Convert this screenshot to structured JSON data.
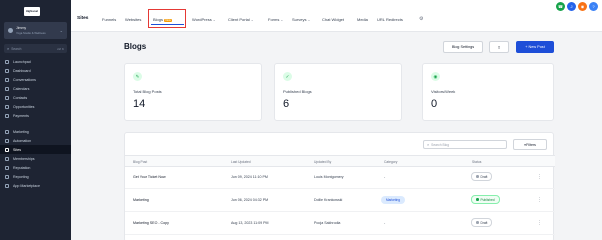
{
  "logo_text": "HighLevel",
  "account": {
    "name": "Jimmy",
    "sub": "Yoga Studio & Wellness"
  },
  "sidebar": {
    "search_placeholder": "Search",
    "search_kbd": "ctrl K",
    "items": [
      {
        "label": "Launchpad",
        "icon": "rocket-icon"
      },
      {
        "label": "Dashboard",
        "icon": "dashboard-icon"
      },
      {
        "label": "Conversations",
        "icon": "chat-icon"
      },
      {
        "label": "Calendars",
        "icon": "calendar-icon"
      },
      {
        "label": "Contacts",
        "icon": "contacts-icon"
      },
      {
        "label": "Opportunities",
        "icon": "funnel-icon"
      },
      {
        "label": "Payments",
        "icon": "payments-icon"
      },
      {
        "label": "Marketing",
        "icon": "megaphone-icon"
      },
      {
        "label": "Automation",
        "icon": "automation-icon"
      },
      {
        "label": "Sites",
        "icon": "globe-icon"
      },
      {
        "label": "Memberships",
        "icon": "membership-icon"
      },
      {
        "label": "Reputation",
        "icon": "star-icon"
      },
      {
        "label": "Reporting",
        "icon": "chart-icon"
      },
      {
        "label": "App Marketplace",
        "icon": "apps-icon"
      }
    ]
  },
  "topbar": {
    "brand": "Sites",
    "tabs": [
      {
        "label": "Funnels"
      },
      {
        "label": "Websites"
      },
      {
        "label": "Blogs",
        "badge": "New"
      },
      {
        "label": "WordPress",
        "chevron": true
      },
      {
        "label": "Client Portal",
        "chevron": true
      },
      {
        "label": "Forms",
        "chevron": true
      },
      {
        "label": "Surveys",
        "chevron": true
      },
      {
        "label": "Chat Widget"
      },
      {
        "label": "Media"
      },
      {
        "label": "URL Redirects"
      }
    ],
    "user_circles": [
      {
        "color": "#16a34a",
        "letter": "☎",
        "name": "phone-icon"
      },
      {
        "color": "#2563eb",
        "letter": "J",
        "name": "avatar"
      },
      {
        "color": "#f97316",
        "letter": "◉",
        "name": "notification-icon"
      },
      {
        "color": "#3b82f6",
        "letter": "?",
        "name": "help-icon"
      },
      {
        "color": "#8b5cf6",
        "letter": "R",
        "name": "user-avatar"
      }
    ]
  },
  "main": {
    "title": "Blogs",
    "buttons": {
      "site_settings": "Blog Settings",
      "new_post": "+ New Post"
    },
    "cards": [
      {
        "label": "Total Blog Posts",
        "value": "14"
      },
      {
        "label": "Published Blogs",
        "value": "6"
      },
      {
        "label": "Visitors/Week",
        "value": "0"
      }
    ],
    "table": {
      "search_placeholder": "Search Blog",
      "filter_label": "Filters",
      "headers": [
        "Blog Post",
        "Last Updated",
        "Updated By",
        "Category",
        "Status"
      ],
      "rows": [
        {
          "title": "Get Your Ticket Now",
          "updated": "Jun 09, 2024 11:10 PM",
          "by": "Louis Montgomery",
          "category": "-",
          "status": "Draft"
        },
        {
          "title": "Marketing",
          "updated": "Jun 06, 2024 04:32 PM",
          "by": "Dollie Krankowski",
          "category": "Marketing",
          "status": "Published"
        },
        {
          "title": "Marketing SEO - Copy",
          "updated": "Aug 13, 2023 11:09 PM",
          "by": "Pooja Sakhrodia",
          "category": "-",
          "status": "Draft"
        }
      ]
    }
  },
  "colors": {
    "accent": "#1d4ed8",
    "highlight": "#e53935",
    "sidebar_bg": "#1e2433"
  }
}
